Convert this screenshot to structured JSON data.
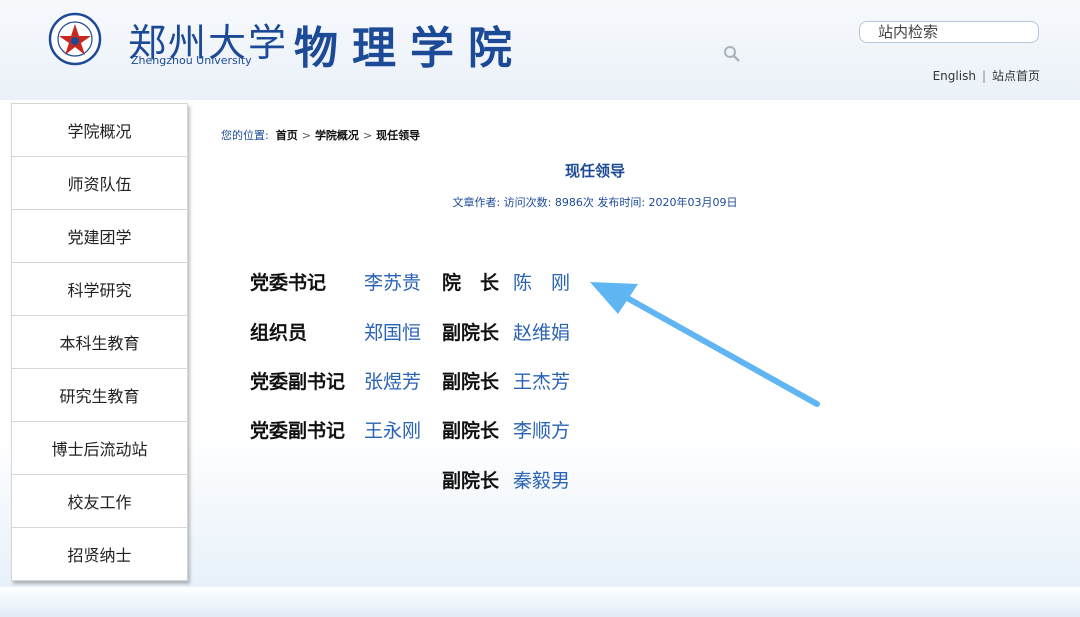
{
  "header": {
    "university_cn": "郑州大学",
    "university_en": "Zhengzhou University",
    "school_name": "物理学院",
    "search_placeholder": "站内检索",
    "links": [
      "English",
      "站点首页"
    ],
    "accent_color": "#1d4a96"
  },
  "sidebar": {
    "items": [
      {
        "label": "学院概况"
      },
      {
        "label": "师资队伍"
      },
      {
        "label": "党建团学"
      },
      {
        "label": "科学研究"
      },
      {
        "label": "本科生教育"
      },
      {
        "label": "研究生教育"
      },
      {
        "label": "博士后流动站"
      },
      {
        "label": "校友工作"
      },
      {
        "label": "招贤纳士"
      }
    ]
  },
  "breadcrumb": {
    "prefix": "您的位置:",
    "items": [
      "首页",
      "学院概况",
      "现任领导"
    ]
  },
  "article": {
    "title": "现任领导",
    "meta": "文章作者:   访问次数: 8986次 发布时间: 2020年03月09日"
  },
  "leaders": {
    "left": [
      {
        "role": "党委书记",
        "name": "李苏贵"
      },
      {
        "role": "组织员",
        "name": "郑国恒"
      },
      {
        "role": "党委副书记",
        "name": "张煜芳"
      },
      {
        "role": "党委副书记",
        "name": "王永刚"
      }
    ],
    "right": [
      {
        "role": "院　长",
        "name": "陈　刚"
      },
      {
        "role": "副院长",
        "name": "赵维娟"
      },
      {
        "role": "副院长",
        "name": "王杰芳"
      },
      {
        "role": "副院长",
        "name": "李顺方"
      },
      {
        "role": "副院长",
        "name": "秦毅男"
      }
    ]
  },
  "annotation": {
    "arrow_color": "#5fb6f2"
  }
}
